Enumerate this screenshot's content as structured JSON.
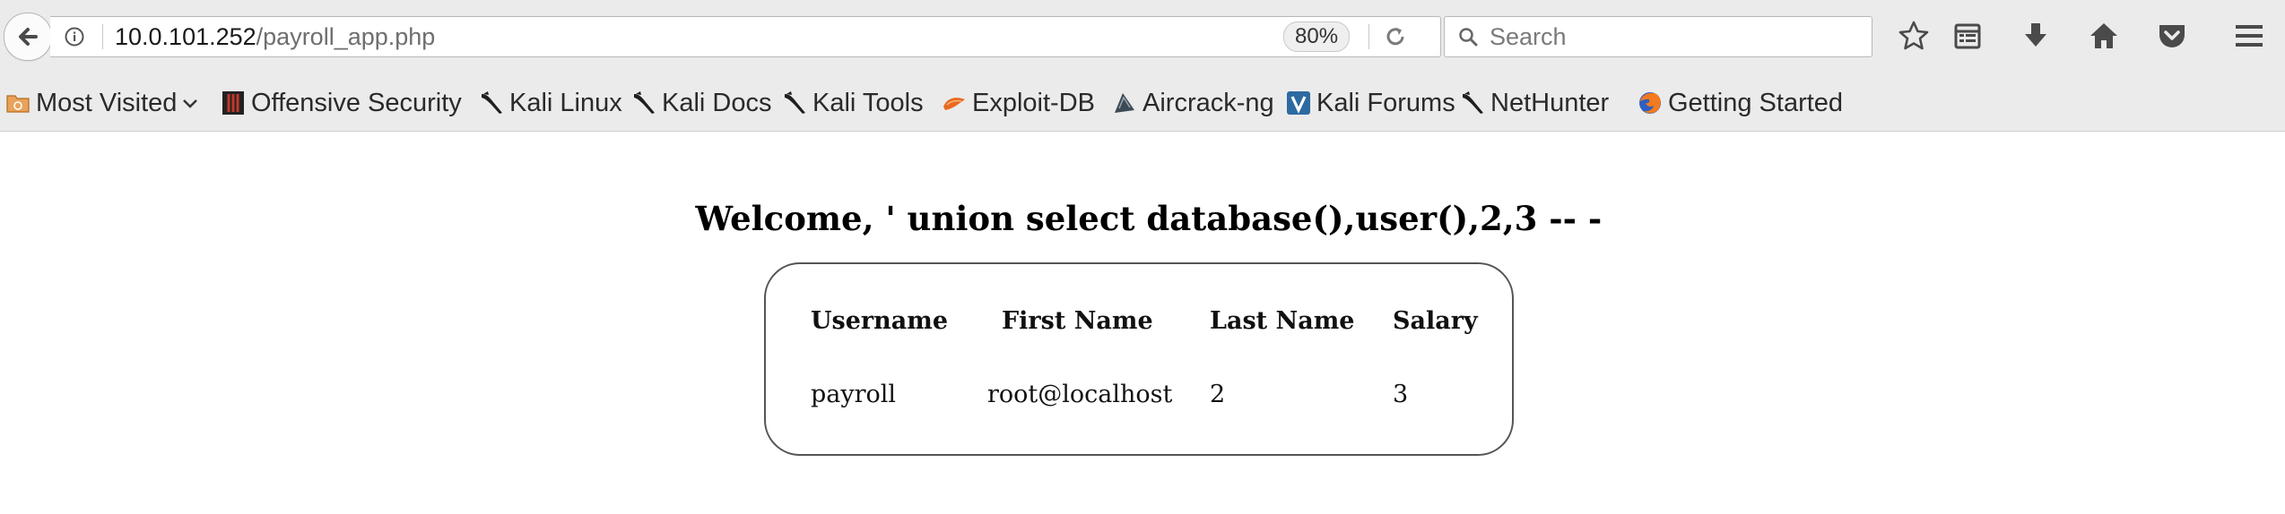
{
  "browser": {
    "url_host": "10.0.101.252",
    "url_path": "/payroll_app.php",
    "zoom": "80%",
    "search_placeholder": "Search"
  },
  "bookmarks": [
    {
      "label": "Most Visited",
      "icon": "folder-icon"
    },
    {
      "label": "Offensive Security",
      "icon": "offsec-icon"
    },
    {
      "label": "Kali Linux",
      "icon": "kali-dragon-icon"
    },
    {
      "label": "Kali Docs",
      "icon": "kali-dragon-icon"
    },
    {
      "label": "Kali Tools",
      "icon": "kali-dragon-icon"
    },
    {
      "label": "Exploit-DB",
      "icon": "exploit-db-icon"
    },
    {
      "label": "Aircrack-ng",
      "icon": "aircrack-icon"
    },
    {
      "label": "Kali Forums",
      "icon": "kali-forums-icon"
    },
    {
      "label": "NetHunter",
      "icon": "kali-dragon-icon"
    },
    {
      "label": "Getting Started",
      "icon": "firefox-icon"
    }
  ],
  "page": {
    "welcome": "Welcome, ' union select database(),user(),2,3 -- -",
    "table": {
      "headers": [
        "Username",
        "First Name",
        "Last Name",
        "Salary"
      ],
      "rows": [
        [
          "payroll",
          "root@localhost",
          "2",
          "3"
        ]
      ]
    }
  }
}
